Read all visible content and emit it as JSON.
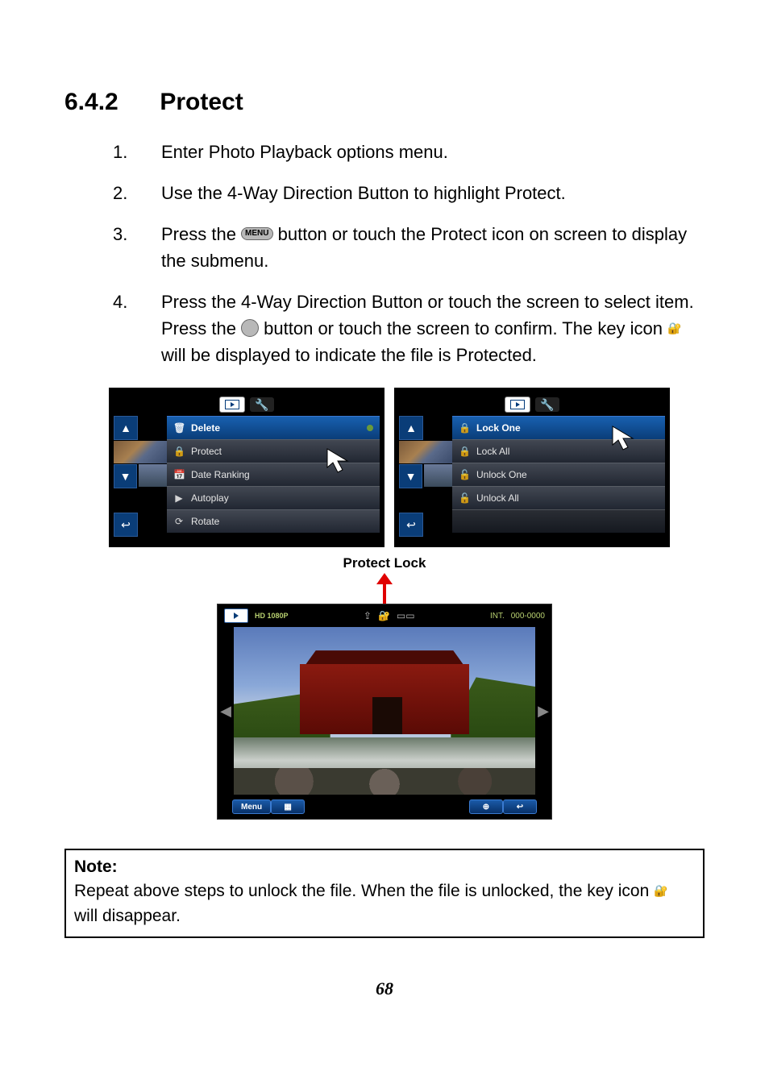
{
  "section": {
    "number": "6.4.2",
    "title": "Protect"
  },
  "steps": [
    {
      "n": "1.",
      "text": "Enter Photo Playback options menu."
    },
    {
      "n": "2.",
      "text": "Use the 4-Way Direction Button to highlight Protect."
    },
    {
      "n": "3.",
      "pre": "Press the ",
      "btn": "MENU",
      "post": " button or touch the Protect icon on screen to display the submenu."
    },
    {
      "n": "4.",
      "l1_pre": "Press the 4-Way Direction Button or touch the screen to select item. Press the ",
      "l1_post": " button or touch the screen to confirm. The key icon ",
      "l1_tail": " will be displayed to indicate the file is Protected."
    }
  ],
  "menu_left": {
    "items": [
      {
        "icon": "🗑",
        "label": "Delete",
        "hl": true,
        "dot": true
      },
      {
        "icon": "🔒",
        "label": "Protect"
      },
      {
        "icon": "📅",
        "label": "Date Ranking"
      },
      {
        "icon": "▶",
        "label": "Autoplay"
      },
      {
        "icon": "⟳",
        "label": "Rotate"
      }
    ]
  },
  "menu_right": {
    "items": [
      {
        "icon": "🔒",
        "label": "Lock One",
        "hl": true
      },
      {
        "icon": "🔒",
        "label": "Lock All"
      },
      {
        "icon": "🔓",
        "label": "Unlock One"
      },
      {
        "icon": "🔓",
        "label": "Unlock All"
      }
    ]
  },
  "protect_lock_label": "Protect Lock",
  "playback": {
    "hd": "HD 1080P",
    "int": "INT.",
    "counter": "000-0000",
    "bottom": {
      "menu": "Menu",
      "grid": "▦",
      "zoom": "⊕",
      "back": "↩"
    }
  },
  "note": {
    "head": "Note:",
    "body_pre": "Repeat above steps to unlock the file. When the file is unlocked, the key icon ",
    "body_post": " will disappear."
  },
  "page_number": "68",
  "key_glyph": "🔐",
  "back_glyph": "↩",
  "up_glyph": "▲",
  "down_glyph": "▼",
  "left_glyph": "◀",
  "right_glyph": "▶",
  "wrench_glyph": "🔧"
}
